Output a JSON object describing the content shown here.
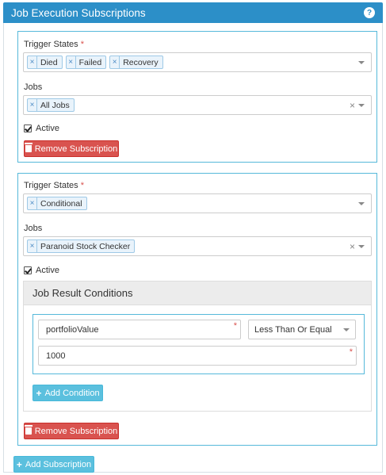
{
  "header": {
    "title": "Job Execution Subscriptions",
    "help_label": "?"
  },
  "labels": {
    "trigger_states": "Trigger States",
    "jobs": "Jobs",
    "active": "Active",
    "required_mark": "*",
    "remove_subscription": "Remove Subscription",
    "chip_remove": "×",
    "clear": "×"
  },
  "subscriptions": [
    {
      "trigger_states": [
        "Died",
        "Failed",
        "Recovery"
      ],
      "jobs": [
        "All Jobs"
      ]
    },
    {
      "trigger_states": [
        "Conditional"
      ],
      "jobs": [
        "Paranoid Stock Checker"
      ],
      "conditions_title": "Job Result Conditions",
      "condition": {
        "field": "portfolioValue",
        "operator": "Less Than Or Equal",
        "value": "1000"
      },
      "add_condition_label": "Add Condition"
    }
  ],
  "add_subscription_label": "Add Subscription"
}
